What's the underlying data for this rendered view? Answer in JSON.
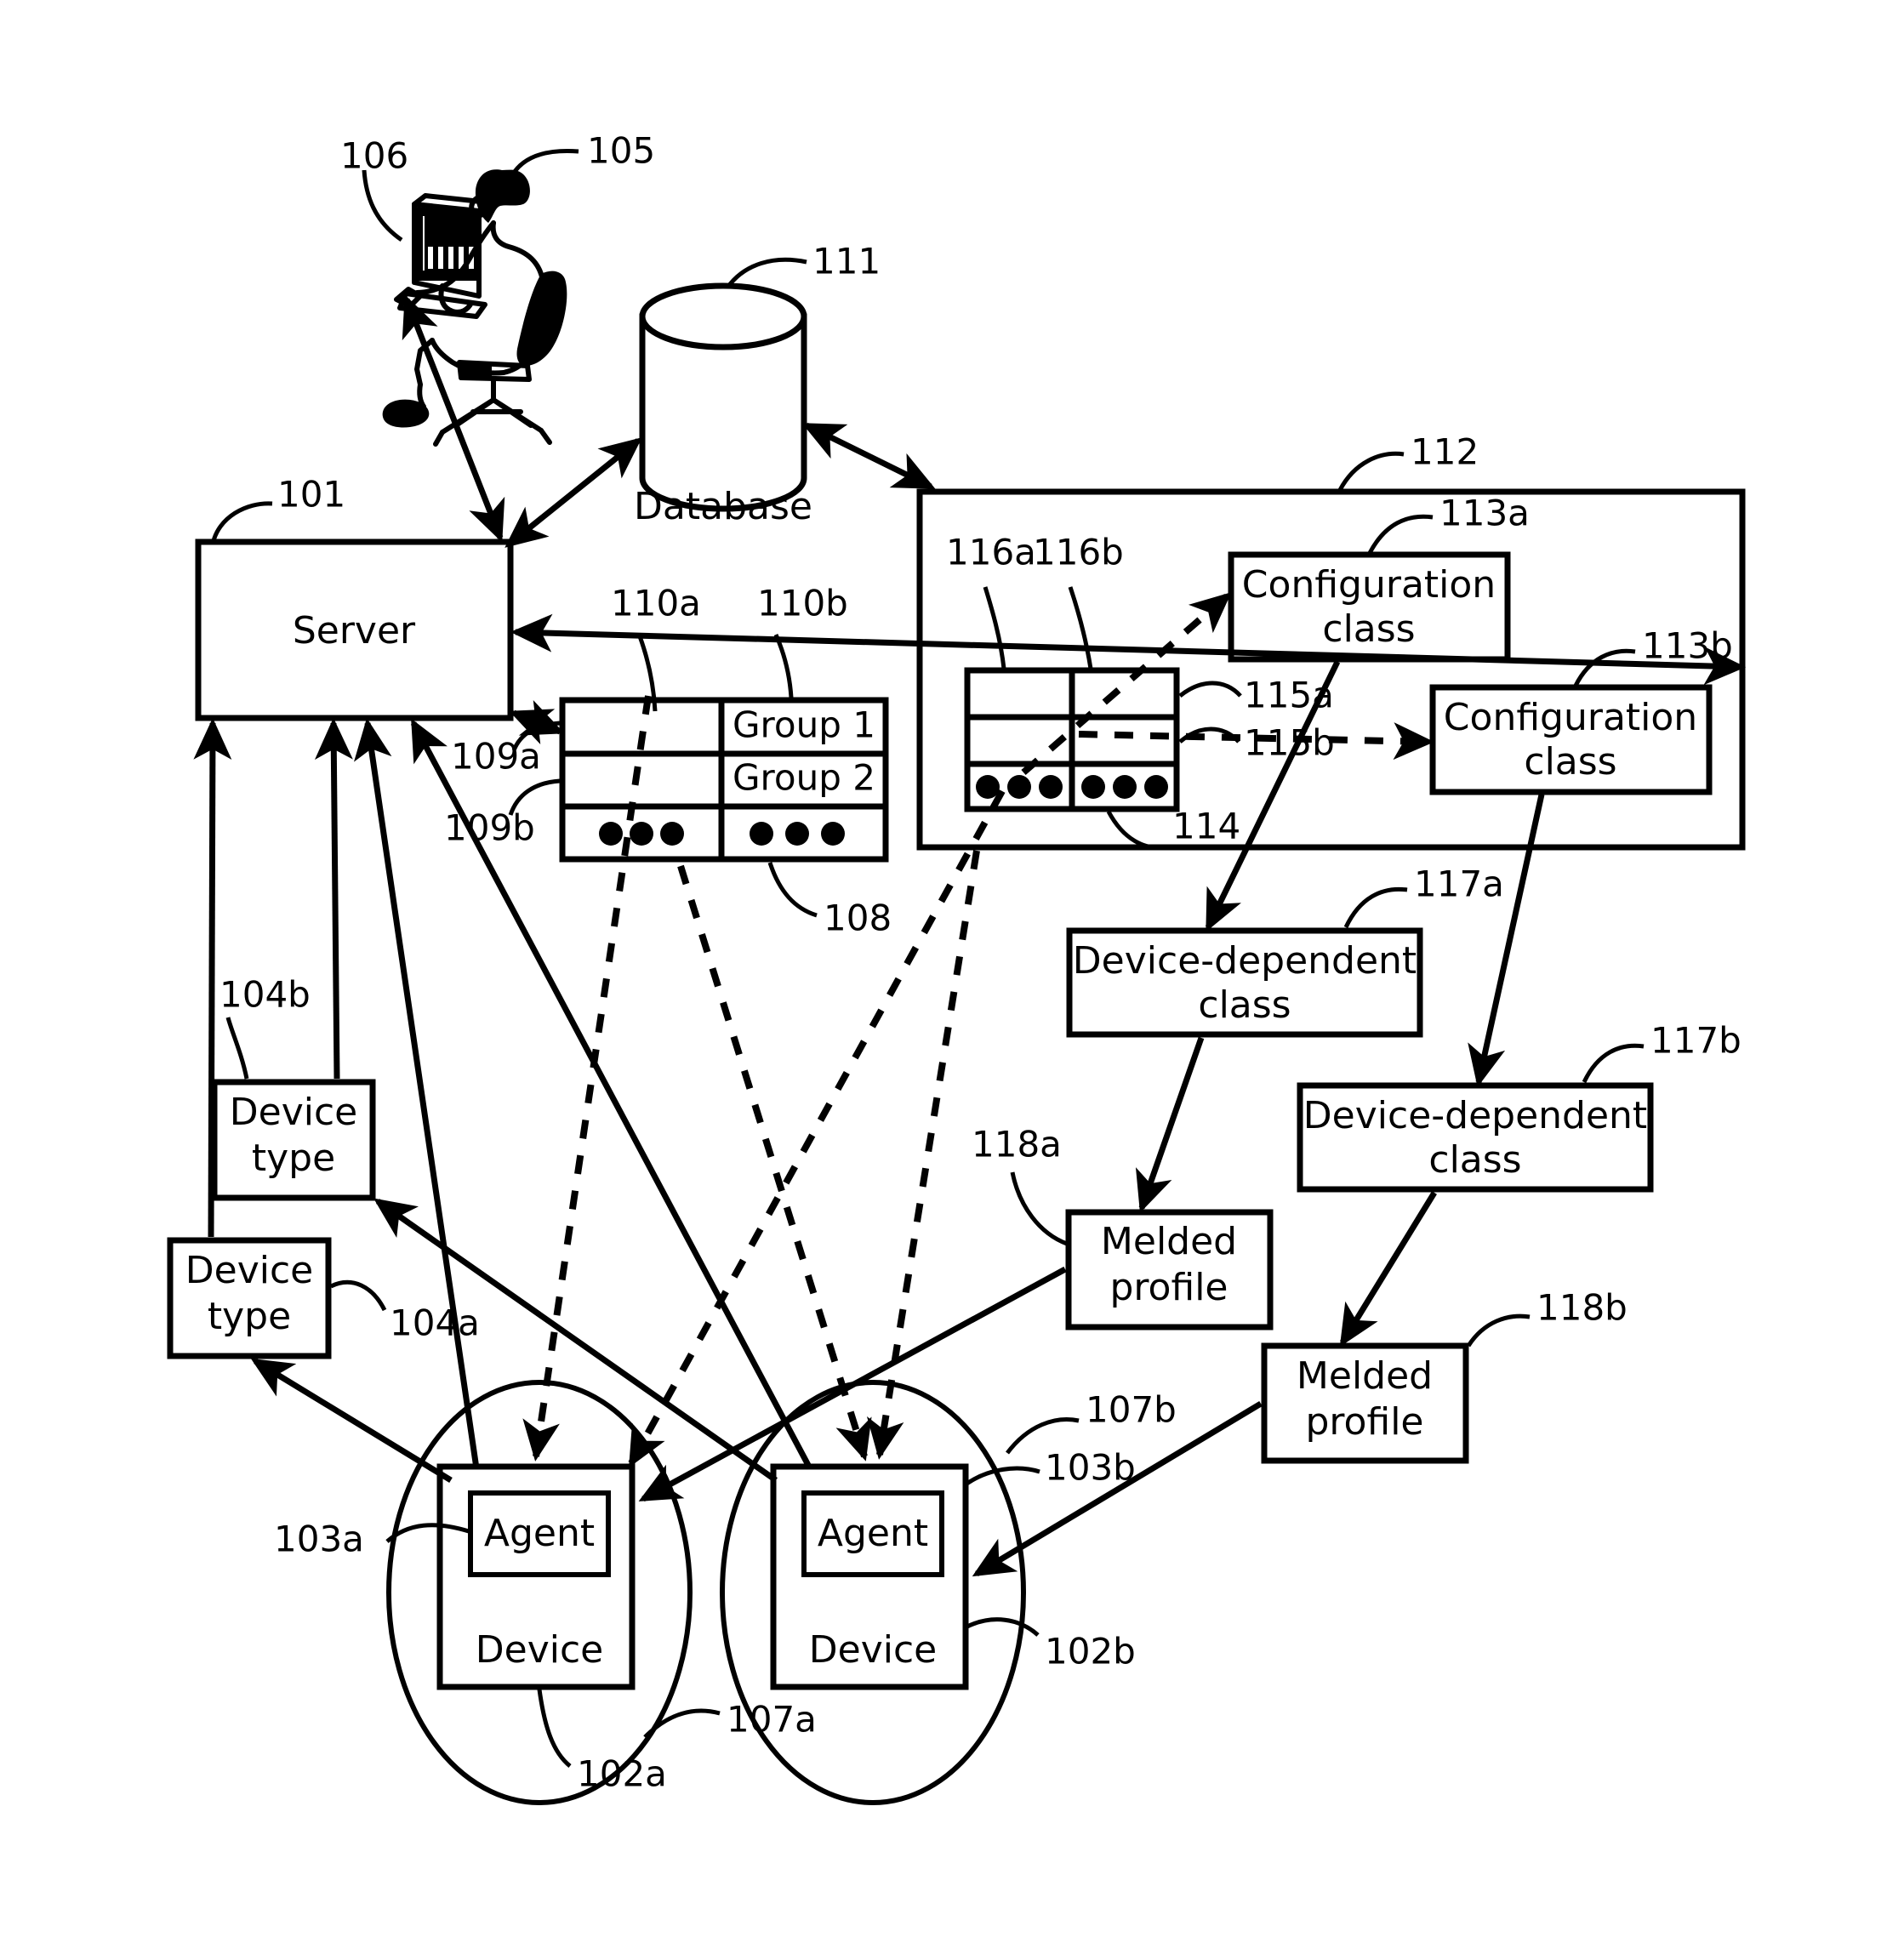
{
  "figure": {
    "title": "Device configuration management system diagram",
    "type": "patent-figure",
    "background_color": "#ffffff",
    "line_color": "#000000"
  },
  "nodes": {
    "server": {
      "label": "Server",
      "ref": "101"
    },
    "database": {
      "label": "Database",
      "ref": "111"
    },
    "operator": {
      "ref": "105"
    },
    "terminal": {
      "ref": "106"
    },
    "group_table": {
      "ref": "108"
    },
    "group_rows": [
      {
        "left": "",
        "right": "Group 1",
        "ref": "110a"
      },
      {
        "left": "",
        "right": "Group 2",
        "ref": "110b"
      },
      {
        "left": "dots",
        "right": "dots",
        "ref": ""
      }
    ],
    "group_row_refs": [
      "109a",
      "109b"
    ],
    "container_112": {
      "ref": "112"
    },
    "class_table_114": {
      "ref": "114"
    },
    "class_table_col_refs": [
      "116a",
      "116b"
    ],
    "class_table_row_refs": [
      "115a",
      "115b"
    ],
    "configuration_class_a": {
      "label_line1": "Configuration",
      "label_line2": "class",
      "ref": "113a"
    },
    "configuration_class_b": {
      "label_line1": "Configuration",
      "label_line2": "class",
      "ref": "113b"
    },
    "device_dependent_class_a": {
      "label_line1": "Device-dependent",
      "label_line2": "class",
      "ref": "117a"
    },
    "device_dependent_class_b": {
      "label_line1": "Device-dependent",
      "label_line2": "class",
      "ref": "117b"
    },
    "melded_profile_a": {
      "label_line1": "Melded",
      "label_line2": "profile",
      "ref": "118a"
    },
    "melded_profile_b": {
      "label_line1": "Melded",
      "label_line2": "profile",
      "ref": "118b"
    },
    "device_type_upper": {
      "label_line1": "Device",
      "label_line2": "type",
      "ref": "104b"
    },
    "device_type_lower": {
      "label_line1": "Device",
      "label_line2": "type",
      "ref": "104a"
    },
    "device_a": {
      "label": "Device",
      "ref": "102a",
      "ellipse_ref": "107a"
    },
    "device_b": {
      "label": "Device",
      "ref": "102b",
      "ellipse_ref": "107b"
    },
    "agent_a": {
      "label": "Agent",
      "ref": "103a"
    },
    "agent_b": {
      "label": "Agent",
      "ref": "103b"
    }
  },
  "reference_numerals": [
    "101",
    "102a",
    "102b",
    "103a",
    "103b",
    "104a",
    "104b",
    "105",
    "106",
    "107a",
    "107b",
    "108",
    "109a",
    "109b",
    "110a",
    "110b",
    "111",
    "112",
    "113a",
    "113b",
    "114",
    "115a",
    "115b",
    "116a",
    "116b",
    "117a",
    "117b",
    "118a",
    "118b"
  ]
}
